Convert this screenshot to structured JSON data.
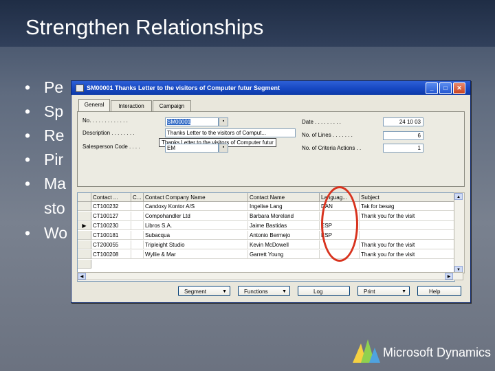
{
  "slide": {
    "title": "Strengthen Relationships",
    "bullets": [
      "Pe",
      "Sp",
      "Re",
      "Pir",
      "Ma"
    ],
    "bullet_continuation": "sto",
    "last_bullet": "Wo"
  },
  "dialog": {
    "caption": "SM00001 Thanks Letter to the visitors of Computer futur    Segment",
    "tabs": [
      "General",
      "Interaction",
      "Campaign"
    ],
    "fields": {
      "no_label": "No. . . .   . . . . . . . . .",
      "no_value": "SM00001",
      "description_label": "Description  . . . . . . . .",
      "description_value": "Thanks Letter to the visitors of Comput...",
      "tooltip": "Thanks Letter to the visitors of Computer futur",
      "salesperson_label": "Salesperson Code . . . .",
      "salesperson_value": "EM",
      "date_label": "Date   . . . . . . . . .",
      "date_value": "24 10 03",
      "lines_label": "No. of Lines . . . . . . .",
      "lines_value": "6",
      "criteria_label": "No. of Criteria Actions . .",
      "criteria_value": "1"
    },
    "grid": {
      "headers": [
        "Contact ...",
        "C...",
        "Contact Company Name",
        "Contact Name",
        "Languag...",
        "Subject"
      ],
      "rows": [
        [
          "CT100232",
          "",
          "Candoxy Kontor A/S",
          "Ingelise Lang",
          "DAN",
          "Tak for besøg"
        ],
        [
          "CT100127",
          "",
          "Compohandler Ltd",
          "Barbara Moreland",
          "",
          "Thank you for the visit"
        ],
        [
          "CT100230",
          "",
          "Libros S.A.",
          "Jaime Bastidas",
          "ESP",
          ""
        ],
        [
          "CT100181",
          "",
          "Subacqua",
          "Antonio Bermejo",
          "ESP",
          ""
        ],
        [
          "CT200055",
          "",
          "Tripleight Studio",
          "Kevin McDowell",
          "",
          "Thank you for the visit"
        ],
        [
          "CT100208",
          "",
          "Wyllie & Mar",
          "Garrett Young",
          "",
          "Thank you for the visit"
        ]
      ]
    },
    "buttons": [
      "Segment",
      "Functions",
      "Log",
      "Print",
      "Help"
    ]
  },
  "logo": {
    "text": "Microsoft Dynamics"
  },
  "colors": {
    "title_bar": "#1f2d45",
    "dialog_title": "#1748c2",
    "highlight_circle": "#d8331e"
  }
}
